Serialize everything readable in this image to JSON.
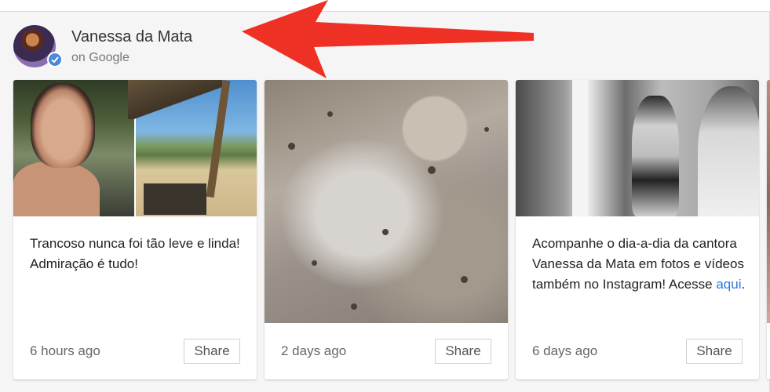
{
  "profile": {
    "name": "Vanessa da Mata",
    "source": "on Google"
  },
  "colors": {
    "arrow": "#ee3124",
    "link": "#2a7ae2",
    "verified_badge": "#4a89dc"
  },
  "icons": {
    "verified": "verified-check-icon",
    "arrow": "annotation-arrow-icon"
  },
  "posts": [
    {
      "text": "Trancoso nunca foi tão leve e linda! Admiração é tudo!",
      "time": "6 hours ago",
      "share": "Share"
    },
    {
      "text": "",
      "time": "2 days ago",
      "share": "Share"
    },
    {
      "text_before_link": "Acompanhe o dia-a-dia da cantora Vanessa da Mata em fotos e vídeos  também no Instagram! Acesse ",
      "link": "aqui",
      "text_after_link": ".",
      "time": "6 days ago",
      "share": "Share"
    }
  ]
}
